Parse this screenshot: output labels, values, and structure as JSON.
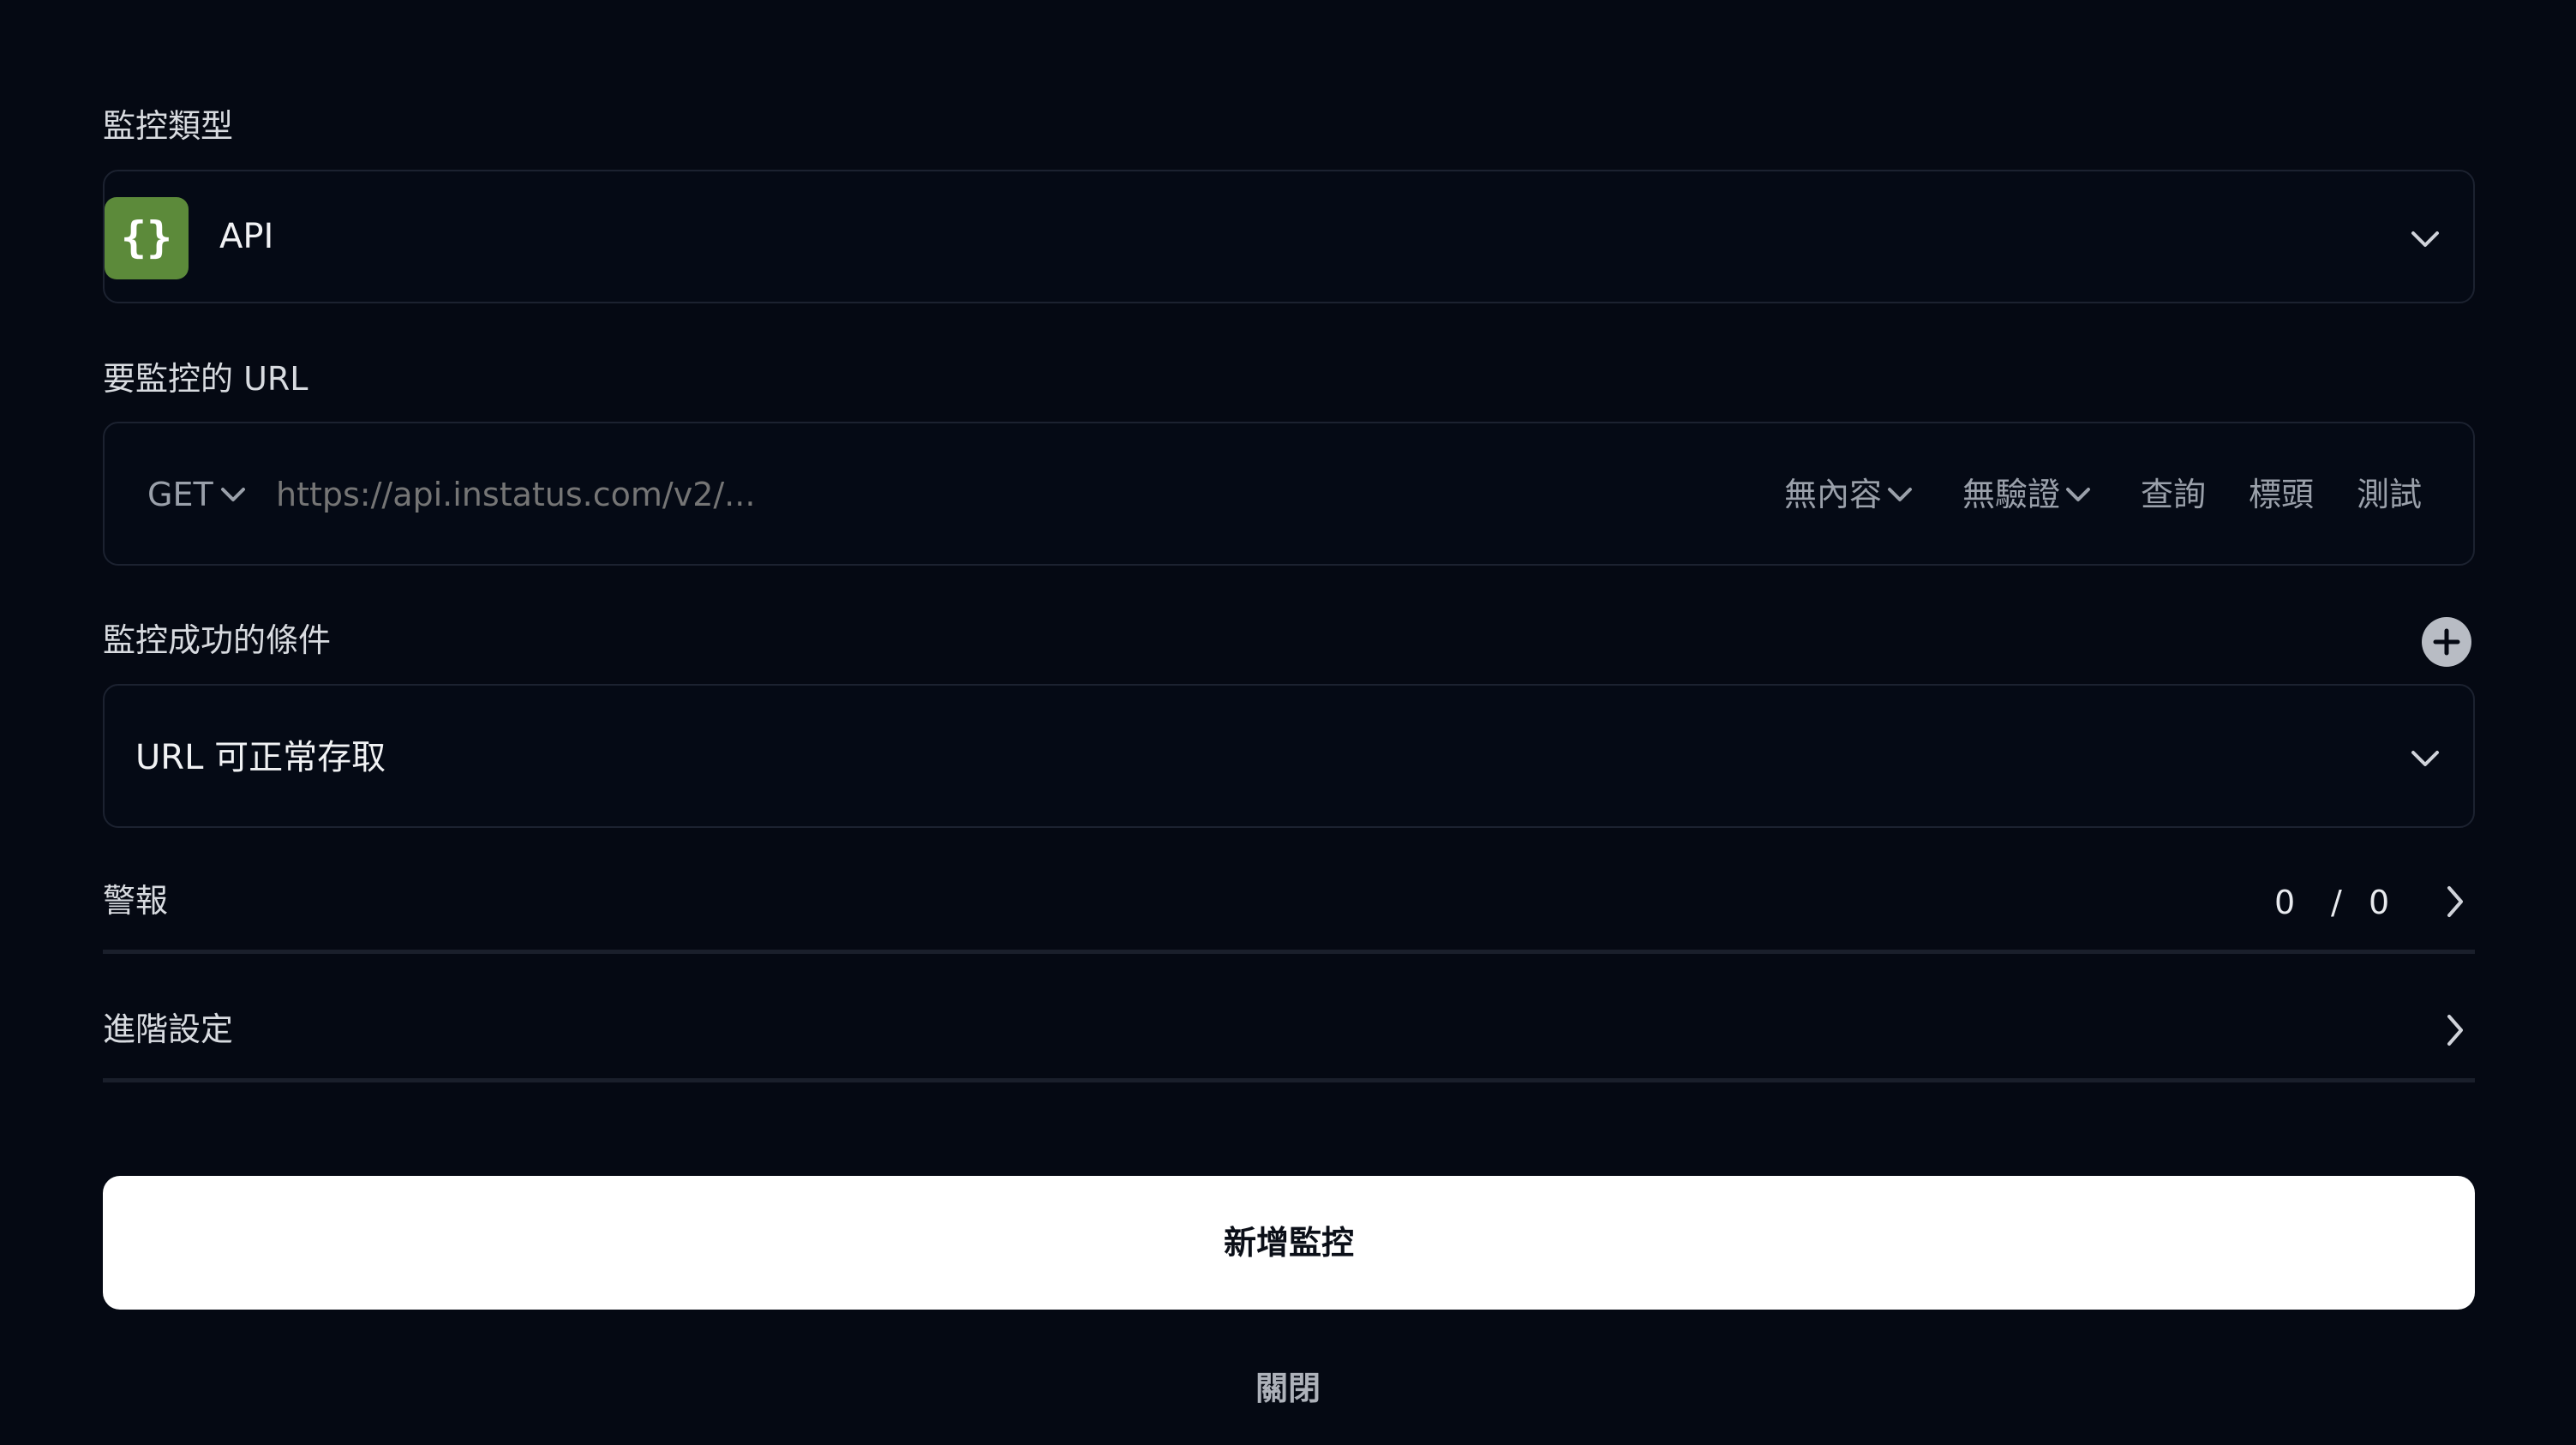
{
  "monitor_type": {
    "label": "監控類型",
    "selected": "API",
    "icon": "braces-icon",
    "icon_color": "#5c8a3a"
  },
  "url": {
    "label": "要監控的 URL",
    "method": "GET",
    "placeholder": "https://api.instatus.com/v2/...",
    "options": {
      "body": "無內容",
      "auth": "無驗證",
      "query": "查詢",
      "headers": "標頭",
      "test": "測試"
    }
  },
  "success_condition": {
    "label": "監控成功的條件",
    "selected": "URL 可正常存取"
  },
  "alerts": {
    "label": "警報",
    "count_left": "0",
    "separator": "/",
    "count_right": "0"
  },
  "advanced": {
    "label": "進階設定"
  },
  "actions": {
    "submit": "新增監控",
    "close": "關閉"
  },
  "colors": {
    "background": "#050913",
    "submit_bg": "#ffffff"
  }
}
